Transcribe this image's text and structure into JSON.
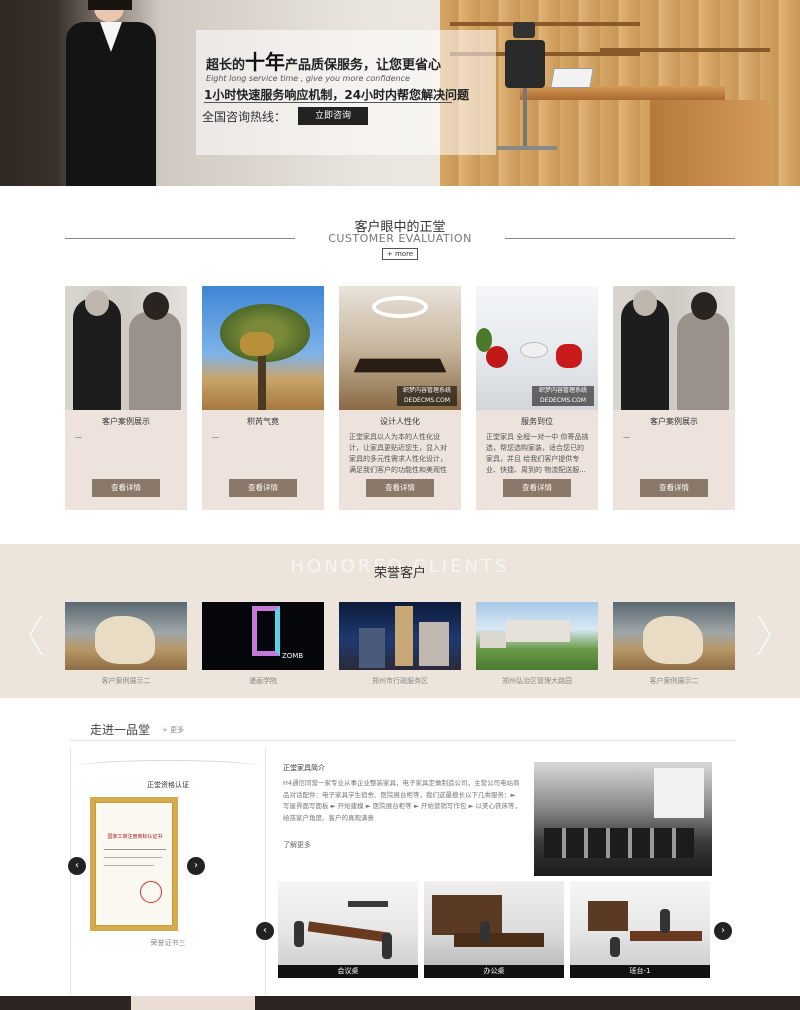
{
  "hero": {
    "title_pre": "超长的",
    "title_big": "十年",
    "title_post": "产品质保服务，让您更省心",
    "subtitle_en": "Eight long service time , give you more confidence",
    "line2": "1小时快速服务响应机制，24小时内帮您解决问题",
    "hotline_label": "全国咨询热线：",
    "consult_button": "立即咨询"
  },
  "evaluation": {
    "title_cn": "客户眼中的正堂",
    "title_en": "CUSTOMER EVALUATION",
    "more": "+ more",
    "cards": [
      {
        "title": "客户案例展示",
        "desc": "—",
        "button": "查看详情"
      },
      {
        "title": "积芮气竟",
        "desc": "—",
        "button": "查看详情",
        "watermark": ""
      },
      {
        "title": "设计人性化",
        "desc": "正堂家具以人为本的人性化设计，让家具更贴近您生，显入对家具的多元性需求人性化设计，满足我们客户的功能性和美观性的多...",
        "button": "查看详情",
        "watermark": "织梦内容管理系统 DEDECMS.COM"
      },
      {
        "title": "服务到位",
        "desc": "正堂家具 全程一对一中 你寄品挑选，帮您选购家装，适合您已的家具，并且 给我们客户提供专业、快捷、周到的 物流配送服...",
        "button": "查看详情",
        "watermark": "织梦内容管理系统 DEDECMS.COM"
      },
      {
        "title": "客户案例展示",
        "desc": "—",
        "button": "查看详情"
      }
    ]
  },
  "clients": {
    "ghost_text": "HONORED CLIENTS",
    "title": "荣誉客户",
    "items": [
      {
        "label": "客户案例展示二"
      },
      {
        "label": "漫画学院"
      },
      {
        "label": "郑州市行政服务区"
      },
      {
        "label": "郑州弘治区管理大路园"
      },
      {
        "label": "客户案例展示二"
      }
    ],
    "neon_caption": "ZOMB"
  },
  "about": {
    "title": "走进一品堂",
    "more": "+ 更多",
    "cert_caption": "正堂资格认证",
    "cert_heading": "国家工商注册商标认证书",
    "cert_label": "荣誉证书三",
    "intro_title": "正堂家具简介",
    "intro_text": "H4通信同营一家专业从事企业整装家具，电子家具定做制造公司，主营公司电站商品对话配件：电子家具学生宿舍、医院展台柜等，我们这最擅长以下几类服务：► 写屋界面写面板 ► 开始建模 ► 医院展台柜等 ► 开始营销写作包 ► 以美心铁床等，给孩家户角度、客户的真观满意",
    "intro_more": "了解更多",
    "products": [
      {
        "label": "会议桌"
      },
      {
        "label": "办公桌"
      },
      {
        "label": "班台-1"
      }
    ]
  },
  "icons": {
    "prev": "‹",
    "next": "›"
  },
  "colors": {
    "card_bg": "#ede3dc",
    "card_button": "#8a7868",
    "clients_bg": "#ede4dc",
    "footer": "#2d2522"
  }
}
